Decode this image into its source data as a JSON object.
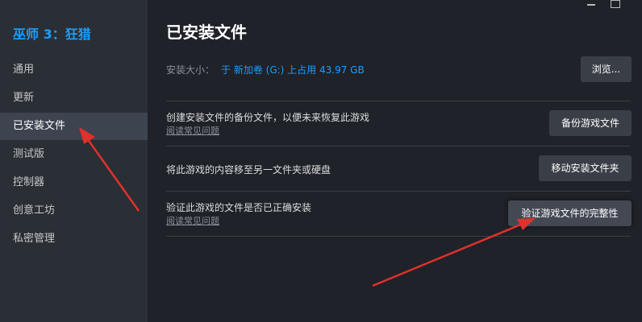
{
  "sidebar": {
    "game_title": "巫师 3：狂猎",
    "items": [
      {
        "label": "通用"
      },
      {
        "label": "更新"
      },
      {
        "label": "已安装文件"
      },
      {
        "label": "测试版"
      },
      {
        "label": "控制器"
      },
      {
        "label": "创意工坊"
      },
      {
        "label": "私密管理"
      }
    ],
    "active_index": 2
  },
  "main": {
    "title": "已安装文件",
    "install_size": {
      "label": "安装大小：",
      "value": "于 新加卷 (G:) 上占用 43.97 GB"
    },
    "browse_button": "浏览...",
    "rows": [
      {
        "text": "创建安装文件的备份文件，以便未来恢复此游戏",
        "link": "阅读常见问题",
        "button": "备份游戏文件"
      },
      {
        "text": "将此游戏的内容移至另一文件夹或硬盘",
        "button": "移动安装文件夹"
      },
      {
        "text": "验证此游戏的文件是否已正确安装",
        "link": "阅读常见问题",
        "button": "验证游戏文件的完整性"
      }
    ]
  },
  "colors": {
    "accent": "#1a9fff",
    "annotation_arrow": "#e0312c",
    "background": "#1f2228",
    "sidebar": "#2a2e35"
  }
}
